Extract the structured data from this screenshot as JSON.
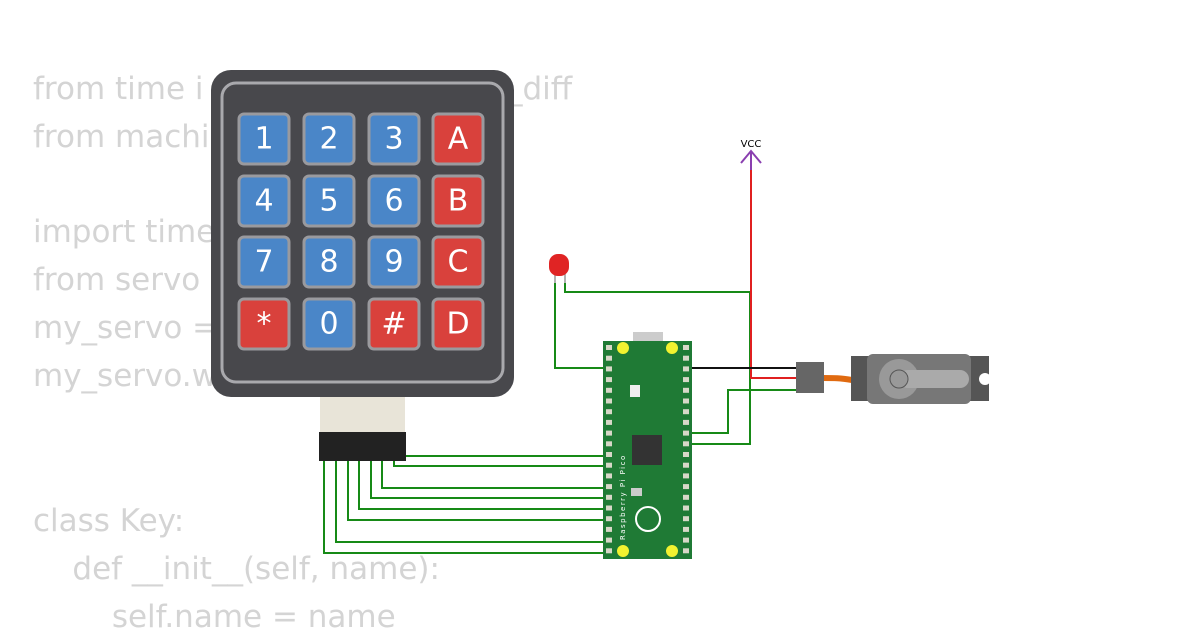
{
  "code_lines": [
    {
      "text": "from time i",
      "tail": "_diff"
    },
    {
      "text": "from machi"
    },
    {
      "text": "import time"
    },
    {
      "text": "from servo i"
    },
    {
      "text": "my_servo = "
    },
    {
      "text": "my_servo.w"
    },
    {
      "text": "class Key:"
    },
    {
      "text": "    def __init__(self, name):"
    },
    {
      "text": "        self.name = name"
    }
  ],
  "keypad": {
    "keys": [
      "1",
      "2",
      "3",
      "A",
      "4",
      "5",
      "6",
      "B",
      "7",
      "8",
      "9",
      "C",
      "*",
      "0",
      "#",
      "D"
    ],
    "colors": {
      "blue": "#4a86c8",
      "red": "#d9413c",
      "body": "#48484c"
    }
  },
  "vcc_label": "VCC",
  "board": {
    "name": "Raspberry Pi Pico",
    "color": "#1f7a35"
  },
  "wire_colors": {
    "signal": "#178a17",
    "power": "#e02020",
    "ground": "#111111"
  }
}
